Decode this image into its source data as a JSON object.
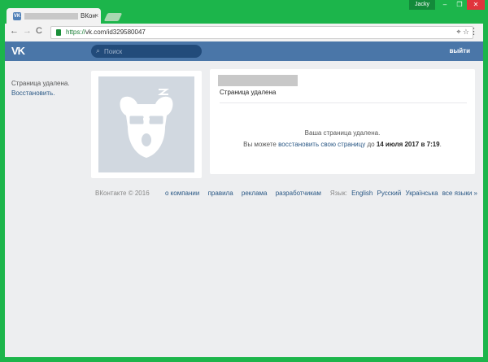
{
  "browser": {
    "tab_title_suffix": "ВКон",
    "tab_favicon": "VK",
    "tab_close": "×",
    "user_chip": "Jacky",
    "window_buttons": [
      "–",
      "❐",
      "✕"
    ],
    "url_scheme": "https://",
    "url_host": "vk.com",
    "url_path": "/id329580047",
    "nav_back": "←",
    "nav_forward": "→",
    "nav_reload": "C",
    "omni_icons": "⌖ ☆",
    "menu": "⋮"
  },
  "header": {
    "logo": "VK",
    "search_placeholder": "Поиск",
    "search_icon": "🔍",
    "logout_label": "выйти"
  },
  "left": {
    "deleted": "Страница удалена.",
    "restore": "Восстановить."
  },
  "profile": {
    "status": "Страница удалена",
    "msg_line1": "Ваша страница удалена.",
    "msg_prefix": "Вы можете",
    "msg_link": "восстановить свою страницу",
    "msg_mid": "до",
    "msg_deadline": "14 июля 2017 в 7:19",
    "msg_end": "."
  },
  "footer": {
    "copyright": "ВКонтакте © 2016",
    "links": [
      "о компании",
      "правила",
      "реклама",
      "разработчикам"
    ],
    "lang_label": "Язык:",
    "languages": [
      "English",
      "Русский",
      "Українська",
      "все языки »"
    ]
  },
  "colors": {
    "vk_blue": "#4a76a8",
    "link": "#2a5885",
    "page_bg": "#edeef0",
    "frame": "#1cb54b"
  }
}
